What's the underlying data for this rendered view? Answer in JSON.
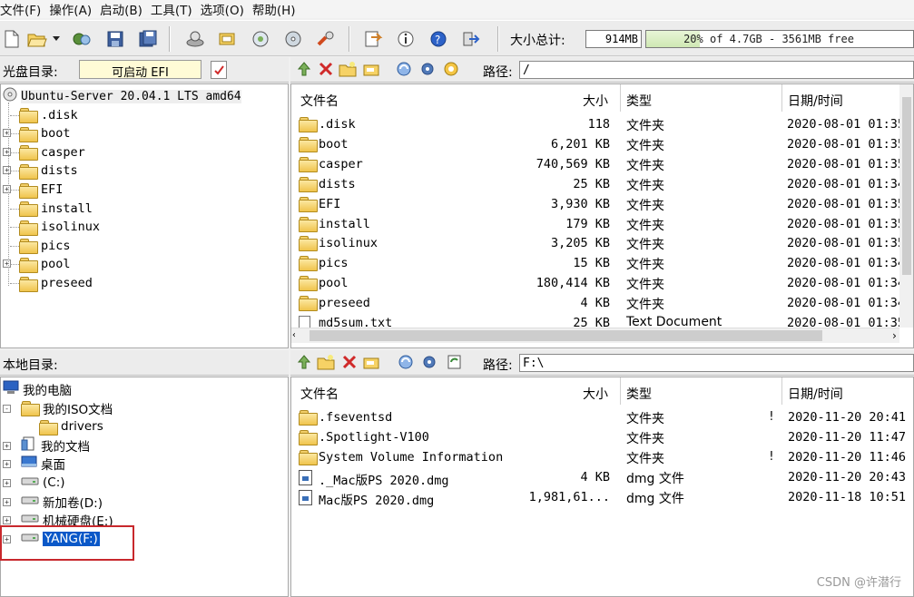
{
  "menu": [
    "文件(F)",
    "操作(A)",
    "启动(B)",
    "工具(T)",
    "选项(O)",
    "帮助(H)"
  ],
  "toolbar": {
    "icons": [
      "new-icon",
      "open-icon",
      "dropdown-arrow-icon",
      "cut-icon",
      "save-icon",
      "save-as-icon",
      "burn-icon",
      "mount-icon",
      "search-icon",
      "disc-icon",
      "tool-icon",
      "extract-icon",
      "info-icon",
      "help-icon",
      "exit-icon"
    ],
    "size_label": "大小总计:",
    "size_value": "914MB",
    "capacity_text": "20% of 4.7GB - 3561MB free",
    "capacity_percent": 20
  },
  "disc_panel": {
    "label": "光盘目录:",
    "boot_label": "可启动 EFI",
    "tree": [
      {
        "label": "Ubuntu-Server 20.04.1 LTS amd64",
        "level": 0,
        "expander": ""
      },
      {
        "label": ".disk",
        "level": 1,
        "expander": ""
      },
      {
        "label": "boot",
        "level": 1,
        "expander": "+"
      },
      {
        "label": "casper",
        "level": 1,
        "expander": "+"
      },
      {
        "label": "dists",
        "level": 1,
        "expander": "+"
      },
      {
        "label": "EFI",
        "level": 1,
        "expander": "+"
      },
      {
        "label": "install",
        "level": 1,
        "expander": ""
      },
      {
        "label": "isolinux",
        "level": 1,
        "expander": ""
      },
      {
        "label": "pics",
        "level": 1,
        "expander": ""
      },
      {
        "label": "pool",
        "level": 1,
        "expander": "+"
      },
      {
        "label": "preseed",
        "level": 1,
        "expander": ""
      }
    ]
  },
  "disc_files": {
    "path_label": "路径:",
    "path": "/",
    "columns": {
      "name": "文件名",
      "size": "大小",
      "type": "类型",
      "date": "日期/时间"
    },
    "rows": [
      {
        "name": ".disk",
        "size": "118",
        "type": "文件夹",
        "date": "2020-08-01 01:35",
        "icon": "folder"
      },
      {
        "name": "boot",
        "size": "6,201 KB",
        "type": "文件夹",
        "date": "2020-08-01 01:35",
        "icon": "folder"
      },
      {
        "name": "casper",
        "size": "740,569 KB",
        "type": "文件夹",
        "date": "2020-08-01 01:35",
        "icon": "folder"
      },
      {
        "name": "dists",
        "size": "25 KB",
        "type": "文件夹",
        "date": "2020-08-01 01:34",
        "icon": "folder"
      },
      {
        "name": "EFI",
        "size": "3,930 KB",
        "type": "文件夹",
        "date": "2020-08-01 01:35",
        "icon": "folder"
      },
      {
        "name": "install",
        "size": "179 KB",
        "type": "文件夹",
        "date": "2020-08-01 01:35",
        "icon": "folder"
      },
      {
        "name": "isolinux",
        "size": "3,205 KB",
        "type": "文件夹",
        "date": "2020-08-01 01:35",
        "icon": "folder"
      },
      {
        "name": "pics",
        "size": "15 KB",
        "type": "文件夹",
        "date": "2020-08-01 01:34",
        "icon": "folder"
      },
      {
        "name": "pool",
        "size": "180,414 KB",
        "type": "文件夹",
        "date": "2020-08-01 01:34",
        "icon": "folder"
      },
      {
        "name": "preseed",
        "size": "4 KB",
        "type": "文件夹",
        "date": "2020-08-01 01:34",
        "icon": "folder"
      },
      {
        "name": "md5sum.txt",
        "size": "25 KB",
        "type": "Text Document",
        "date": "2020-08-01 01:35",
        "icon": "text-file"
      }
    ]
  },
  "local_panel": {
    "label": "本地目录:",
    "tree": [
      {
        "label": "我的电脑",
        "level": 0,
        "expander": "",
        "icon": "computer-icon"
      },
      {
        "label": "我的ISO文档",
        "level": 1,
        "expander": "-",
        "icon": "folder-icon"
      },
      {
        "label": "drivers",
        "level": 2,
        "expander": "",
        "icon": "folder-icon"
      },
      {
        "label": "我的文档",
        "level": 1,
        "expander": "+",
        "icon": "documents-icon"
      },
      {
        "label": "桌面",
        "level": 1,
        "expander": "+",
        "icon": "desktop-icon"
      },
      {
        "label": "(C:)",
        "level": 1,
        "expander": "+",
        "icon": "drive-icon"
      },
      {
        "label": "新加卷(D:)",
        "level": 1,
        "expander": "+",
        "icon": "drive-icon"
      },
      {
        "label": "机械硬盘(E:)",
        "level": 1,
        "expander": "+",
        "icon": "drive-icon"
      },
      {
        "label": "YANG(F:)",
        "level": 1,
        "expander": "+",
        "icon": "drive-icon",
        "selected": true
      }
    ]
  },
  "local_files": {
    "path_label": "路径:",
    "path": "F:\\",
    "columns": {
      "name": "文件名",
      "size": "大小",
      "type": "类型",
      "date": "日期/时间"
    },
    "rows": [
      {
        "name": ".fseventsd",
        "size": "",
        "type": "文件夹",
        "flag": "!",
        "date": "2020-11-20 20:41",
        "icon": "folder"
      },
      {
        "name": ".Spotlight-V100",
        "size": "",
        "type": "文件夹",
        "flag": "",
        "date": "2020-11-20 11:47",
        "icon": "folder"
      },
      {
        "name": "System Volume Information",
        "size": "",
        "type": "文件夹",
        "flag": "!",
        "date": "2020-11-20 11:46",
        "icon": "folder"
      },
      {
        "name": "._Mac版PS 2020.dmg",
        "size": "4 KB",
        "type": "dmg 文件",
        "flag": "",
        "date": "2020-11-20 20:43",
        "icon": "dmg"
      },
      {
        "name": "Mac版PS 2020.dmg",
        "size": "1,981,61...",
        "type": "dmg 文件",
        "flag": "",
        "date": "2020-11-18 10:51",
        "icon": "dmg"
      }
    ]
  },
  "watermark": "CSDN @许潜行",
  "colors": {
    "selection": "#0a58c8",
    "highlight_box": "#c8282c",
    "capacity_fill": "#cfe8b3"
  }
}
